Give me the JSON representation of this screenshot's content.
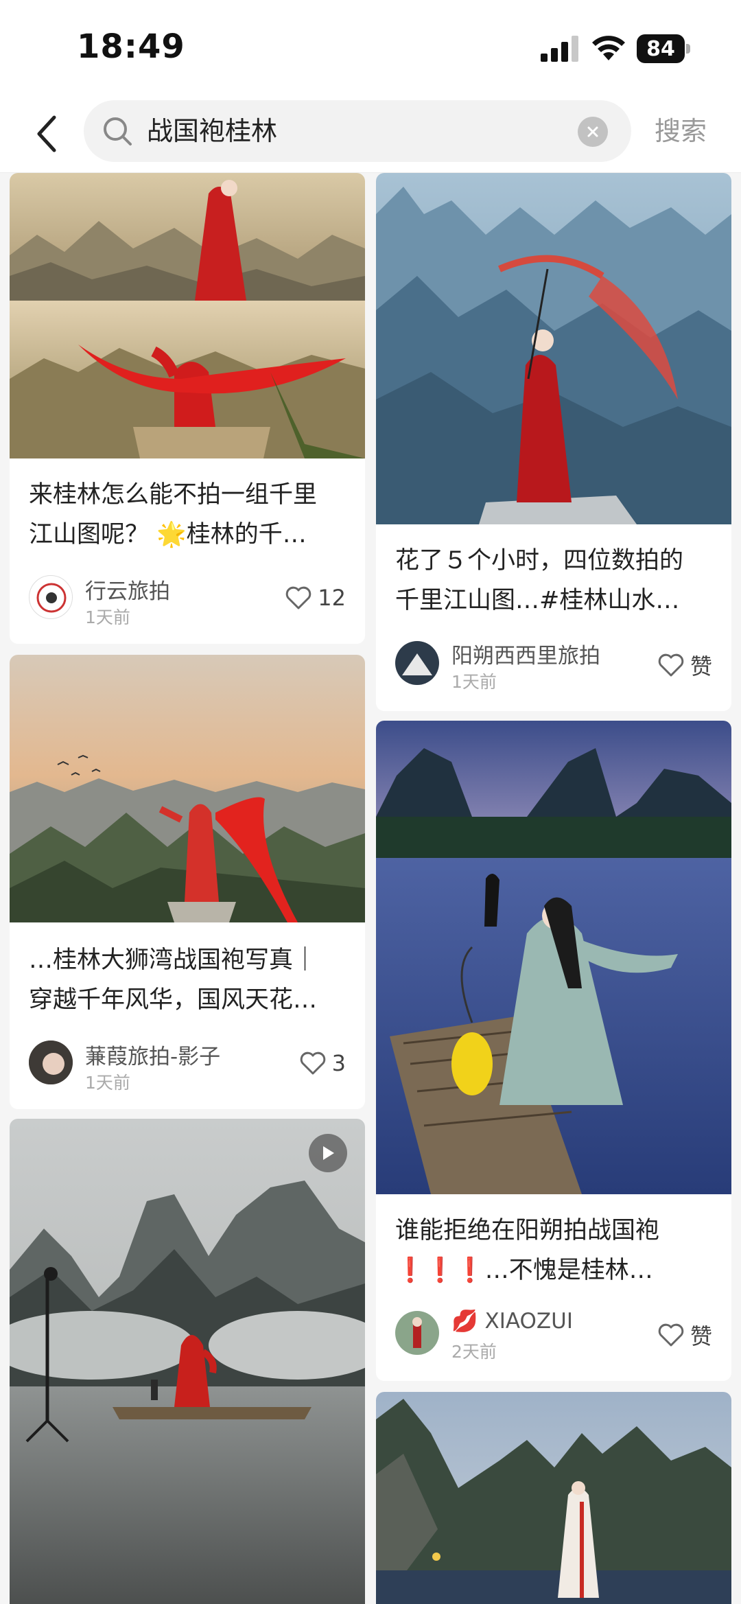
{
  "status_bar": {
    "time": "18:49",
    "battery": "84"
  },
  "search": {
    "query": "战国袍桂林",
    "button_label": "搜索"
  },
  "feed": {
    "left": [
      {
        "title_lines": [
          "来桂林怎么能不拍一组千里",
          "江山图呢？ 🌟桂林的千…"
        ],
        "author": "行云旅拍",
        "time": "1天前",
        "likes": "12"
      },
      {
        "title_lines": [
          "…桂林大狮湾战国袍写真｜",
          "穿越千年风华，国风天花…"
        ],
        "author": "蒹葭旅拍-影子",
        "time": "1天前",
        "likes": "3"
      },
      {
        "has_video": true
      }
    ],
    "right": [
      {
        "title_lines": [
          "花了５个小时，四位数拍的",
          "千里江山图…#桂林山水…"
        ],
        "author": "阳朔西西里旅拍",
        "time": "1天前",
        "likes": "赞"
      },
      {
        "title_lines": [
          "谁能拒绝在阳朔拍战国袍",
          "❗❗❗…不愧是桂林…"
        ],
        "author": "💋 XIAOZUI",
        "time": "2天前",
        "likes": "赞"
      },
      {}
    ]
  }
}
